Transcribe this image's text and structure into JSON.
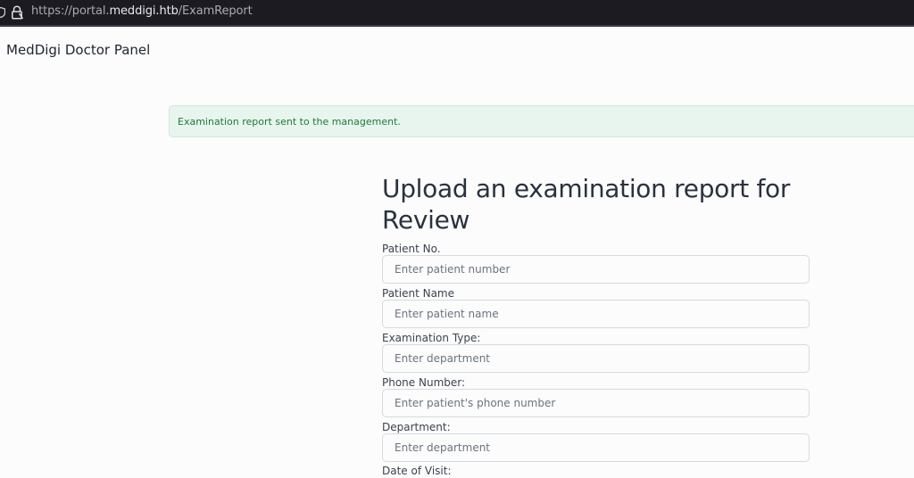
{
  "browser": {
    "url_prefix": "https://portal.",
    "url_host": "meddigi.htb",
    "url_path": "/ExamReport"
  },
  "app": {
    "brand": "MedDigi Doctor Panel"
  },
  "alert": {
    "message": "Examination report sent to the management."
  },
  "form": {
    "title": "Upload an examination report for Review",
    "fields": [
      {
        "label": "Patient No.",
        "placeholder": "Enter patient number",
        "value": ""
      },
      {
        "label": "Patient Name",
        "placeholder": "Enter patient name",
        "value": ""
      },
      {
        "label": "Examination Type:",
        "placeholder": "Enter department",
        "value": ""
      },
      {
        "label": "Phone Number:",
        "placeholder": "Enter patient's phone number",
        "value": ""
      },
      {
        "label": "Department:",
        "placeholder": "Enter department",
        "value": ""
      },
      {
        "label": "Date of Visit:",
        "placeholder": "",
        "value": ""
      }
    ]
  },
  "colors": {
    "page_background": "#fbfcfb",
    "alert_background": "#e8f5ee",
    "alert_text": "#1d7a38",
    "browser_bar": "#1c1b22"
  },
  "icons": {
    "tracking_protection": "shield-icon",
    "site_security": "lock-icon"
  }
}
